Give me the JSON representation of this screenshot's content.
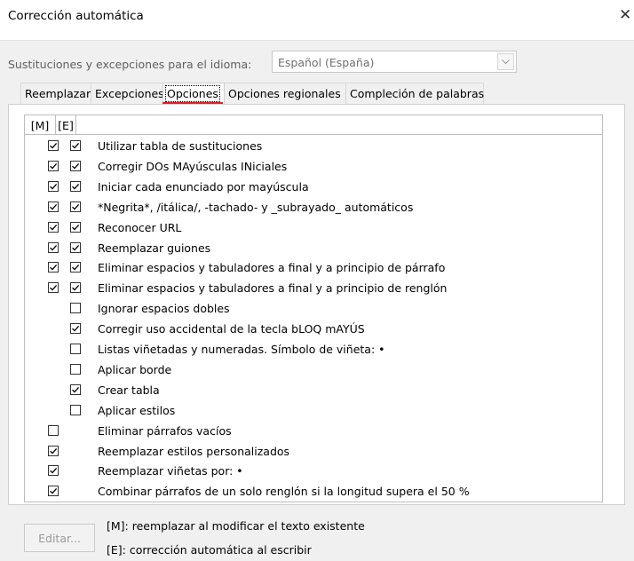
{
  "window": {
    "title": "Corrección automática",
    "close_glyph": "✕"
  },
  "language": {
    "label": "Sustituciones y excepciones para el idioma:",
    "selected": "Español (España)",
    "dropdown_icon": "chevron-down-icon"
  },
  "tabs": [
    {
      "label": "Reemplazar",
      "active": false
    },
    {
      "label": "Excepciones",
      "active": false
    },
    {
      "label": "Opciones",
      "active": true
    },
    {
      "label": "Opciones regionales",
      "active": false
    },
    {
      "label": "Compleción de palabras",
      "active": false
    }
  ],
  "options": {
    "col_m": "[M]",
    "col_e": "[E]",
    "rows": [
      {
        "label": "Utilizar tabla de sustituciones",
        "m": true,
        "e": true
      },
      {
        "label": "Corregir DOs MAyúsculas INiciales",
        "m": true,
        "e": true
      },
      {
        "label": "Iniciar cada enunciado por mayúscula",
        "m": true,
        "e": true
      },
      {
        "label": "*Negrita*, /itálica/, -tachado- y _subrayado_ automáticos",
        "m": true,
        "e": true
      },
      {
        "label": "Reconocer URL",
        "m": true,
        "e": true
      },
      {
        "label": "Reemplazar guiones",
        "m": true,
        "e": true
      },
      {
        "label": "Eliminar espacios y tabuladores a final y a principio de párrafo",
        "m": true,
        "e": true
      },
      {
        "label": "Eliminar espacios y tabuladores a final y a principio de renglón",
        "m": true,
        "e": true
      },
      {
        "label": "Ignorar espacios dobles",
        "m": null,
        "e": false
      },
      {
        "label": "Corregir uso accidental de la tecla bLOQ mAYÚS",
        "m": null,
        "e": true
      },
      {
        "label": "Listas viñetadas y numeradas. Símbolo de viñeta: •",
        "m": null,
        "e": false
      },
      {
        "label": "Aplicar borde",
        "m": null,
        "e": false
      },
      {
        "label": "Crear tabla",
        "m": null,
        "e": true
      },
      {
        "label": "Aplicar estilos",
        "m": null,
        "e": false
      },
      {
        "label": "Eliminar párrafos vacíos",
        "m": false,
        "e": null
      },
      {
        "label": "Reemplazar estilos personalizados",
        "m": true,
        "e": null
      },
      {
        "label": "Reemplazar viñetas por: •",
        "m": true,
        "e": null
      },
      {
        "label": "Combinar párrafos de un solo renglón si la longitud supera el 50 %",
        "m": true,
        "e": null
      }
    ]
  },
  "footer": {
    "edit_button": "Editar...",
    "legend_m": "[M]: reemplazar al modificar el texto existente",
    "legend_e": "[E]: corrección automática al escribir"
  },
  "colors": {
    "active_tab_marker": "#e0202a"
  }
}
